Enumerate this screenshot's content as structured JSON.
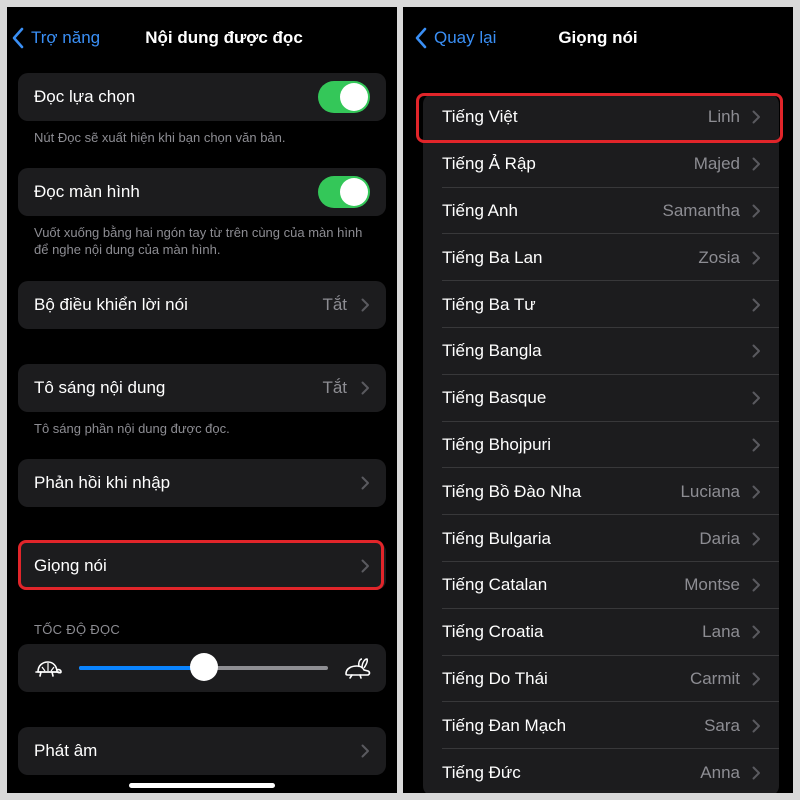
{
  "left": {
    "nav": {
      "back_label": "Trợ năng",
      "title": "Nội dung được đọc"
    },
    "speak_selection": {
      "label": "Đọc lựa chọn",
      "on": true,
      "footer": "Nút Đọc sẽ xuất hiện khi bạn chọn văn bản."
    },
    "speak_screen": {
      "label": "Đọc màn hình",
      "on": true,
      "footer": "Vuốt xuống bằng hai ngón tay từ trên cùng của màn hình để nghe nội dung của màn hình."
    },
    "speech_controller": {
      "label": "Bộ điều khiển lời nói",
      "value": "Tắt"
    },
    "highlight_content": {
      "label": "Tô sáng nội dung",
      "value": "Tắt",
      "footer": "Tô sáng phần nội dung được đọc."
    },
    "typing_feedback": {
      "label": "Phản hồi khi nhập"
    },
    "voices": {
      "label": "Giọng nói"
    },
    "speaking_rate": {
      "section": "TỐC ĐỘ ĐỌC",
      "value_fraction": 0.5
    },
    "pronunciations": {
      "label": "Phát âm"
    }
  },
  "right": {
    "nav": {
      "back_label": "Quay lại",
      "title": "Giọng nói"
    },
    "languages": [
      {
        "name": "Tiếng Việt",
        "voice": "Linh"
      },
      {
        "name": "Tiếng Ả Rập",
        "voice": "Majed"
      },
      {
        "name": "Tiếng Anh",
        "voice": "Samantha"
      },
      {
        "name": "Tiếng Ba Lan",
        "voice": "Zosia"
      },
      {
        "name": "Tiếng Ba Tư",
        "voice": ""
      },
      {
        "name": "Tiếng Bangla",
        "voice": ""
      },
      {
        "name": "Tiếng Basque",
        "voice": ""
      },
      {
        "name": "Tiếng Bhojpuri",
        "voice": ""
      },
      {
        "name": "Tiếng Bồ Đào Nha",
        "voice": "Luciana"
      },
      {
        "name": "Tiếng Bulgaria",
        "voice": "Daria"
      },
      {
        "name": "Tiếng Catalan",
        "voice": "Montse"
      },
      {
        "name": "Tiếng Croatia",
        "voice": "Lana"
      },
      {
        "name": "Tiếng Do Thái",
        "voice": "Carmit"
      },
      {
        "name": "Tiếng Đan Mạch",
        "voice": "Sara"
      },
      {
        "name": "Tiếng Đức",
        "voice": "Anna"
      }
    ]
  },
  "colors": {
    "accent": "#0a84ff",
    "toggle_on": "#34c759",
    "highlight": "#e1252a"
  }
}
